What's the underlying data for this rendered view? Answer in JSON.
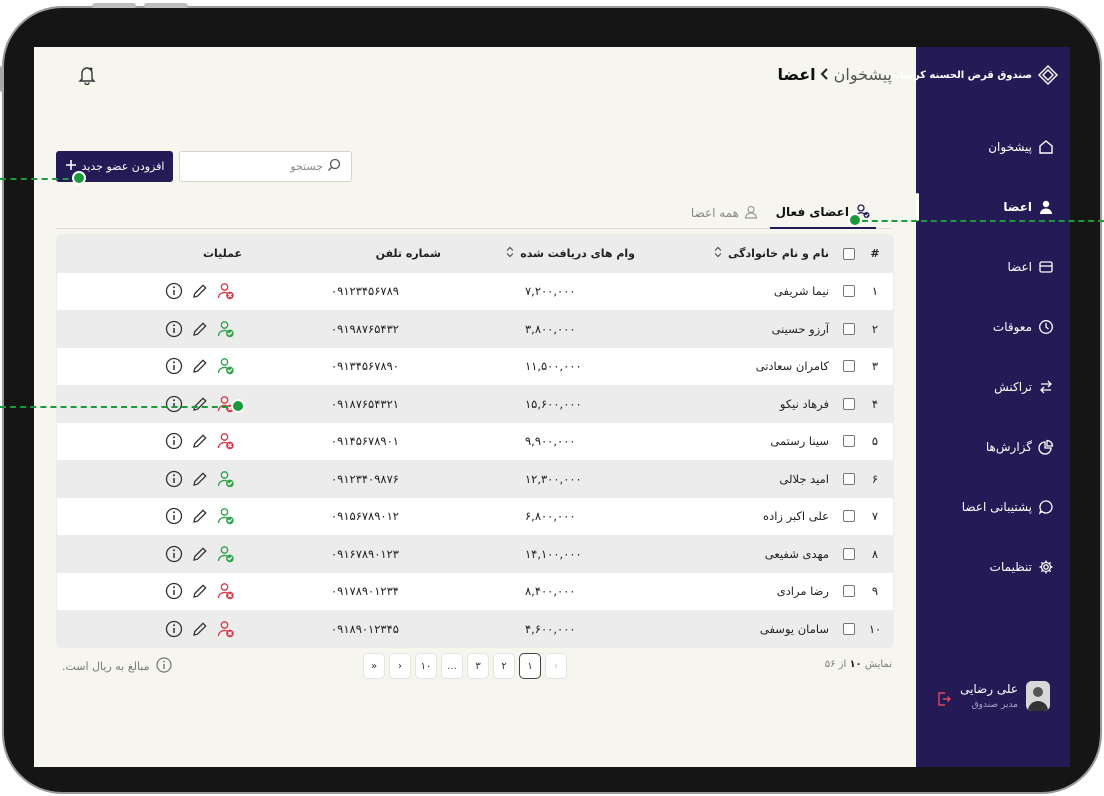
{
  "brand": {
    "name": "صندوق قرض الحسنه کریمانه"
  },
  "sidebar": {
    "items": [
      {
        "label": "پیشخوان",
        "icon": "home-icon",
        "active": false
      },
      {
        "label": "اعضا",
        "icon": "user-icon",
        "active": true
      },
      {
        "label": "اعضا",
        "icon": "card-icon",
        "active": false
      },
      {
        "label": "معوقات",
        "icon": "clock-icon",
        "active": false
      },
      {
        "label": "تراکنش",
        "icon": "transfer-icon",
        "active": false
      },
      {
        "label": "گزارش‌ها",
        "icon": "pie-chart-icon",
        "active": false
      },
      {
        "label": "پشتیبانی اعضا",
        "icon": "chat-bubble-icon",
        "active": false
      },
      {
        "label": "تنظیمات",
        "icon": "gear-icon",
        "active": false
      }
    ]
  },
  "user": {
    "name": "علی رضایی",
    "role": "مدیر صندوق"
  },
  "header": {
    "breadcrumb_parent": "پیشخوان",
    "breadcrumb_current": "اعضا"
  },
  "toolbar": {
    "add_label": "افزودن عضو جدید",
    "search_placeholder": "جستجو"
  },
  "tabs": {
    "active": "اعضای فعال",
    "inactive": "همه اعضا"
  },
  "table": {
    "headers": {
      "num": "#",
      "name": "نام و نام خانوادگی",
      "loans": "وام های دریافت شده",
      "phone": "شماره تلفن",
      "ops": "عملیات"
    },
    "rows": [
      {
        "num": "۱",
        "name": "نیما شریفی",
        "loan": "۷,۲۰۰,۰۰۰",
        "phone": "۰۹۱۲۳۴۵۶۷۸۹",
        "status": "inactive"
      },
      {
        "num": "۲",
        "name": "آرزو حسینی",
        "loan": "۳,۸۰۰,۰۰۰",
        "phone": "۰۹۱۹۸۷۶۵۴۳۲",
        "status": "active"
      },
      {
        "num": "۳",
        "name": "کامران سعادتی",
        "loan": "۱۱,۵۰۰,۰۰۰",
        "phone": "۰۹۱۳۴۵۶۷۸۹۰",
        "status": "active"
      },
      {
        "num": "۴",
        "name": "فرهاد نیکو",
        "loan": "۱۵,۶۰۰,۰۰۰",
        "phone": "۰۹۱۸۷۶۵۴۳۲۱",
        "status": "inactive"
      },
      {
        "num": "۵",
        "name": "سینا رستمی",
        "loan": "۹,۹۰۰,۰۰۰",
        "phone": "۰۹۱۴۵۶۷۸۹۰۱",
        "status": "inactive"
      },
      {
        "num": "۶",
        "name": "امید جلالی",
        "loan": "۱۲,۳۰۰,۰۰۰",
        "phone": "۰۹۱۲۳۴۰۹۸۷۶",
        "status": "active"
      },
      {
        "num": "۷",
        "name": "علی اکبر زاده",
        "loan": "۶,۸۰۰,۰۰۰",
        "phone": "۰۹۱۵۶۷۸۹۰۱۲",
        "status": "active"
      },
      {
        "num": "۸",
        "name": "مهدی شفیعی",
        "loan": "۱۴,۱۰۰,۰۰۰",
        "phone": "۰۹۱۶۷۸۹۰۱۲۳",
        "status": "active"
      },
      {
        "num": "۹",
        "name": "رضا مرادی",
        "loan": "۸,۴۰۰,۰۰۰",
        "phone": "۰۹۱۷۸۹۰۱۲۳۴",
        "status": "inactive"
      },
      {
        "num": "۱۰",
        "name": "سامان یوسفی",
        "loan": "۴,۶۰۰,۰۰۰",
        "phone": "۰۹۱۸۹۰۱۲۳۴۵",
        "status": "inactive"
      }
    ]
  },
  "footer": {
    "note": "مبالغ به ریال است.",
    "showing_prefix": "نمایش",
    "showing_count": "۱۰",
    "showing_mid": "از",
    "showing_total": "۵۶"
  },
  "pagination": [
    "‹",
    "۱",
    "۲",
    "۳",
    "...",
    "۱۰",
    "›",
    "»"
  ],
  "colors": {
    "brand": "#241a55",
    "active_status": "#2fa34a",
    "inactive_status": "#d63a4a",
    "callout": "#1a9a3c"
  }
}
